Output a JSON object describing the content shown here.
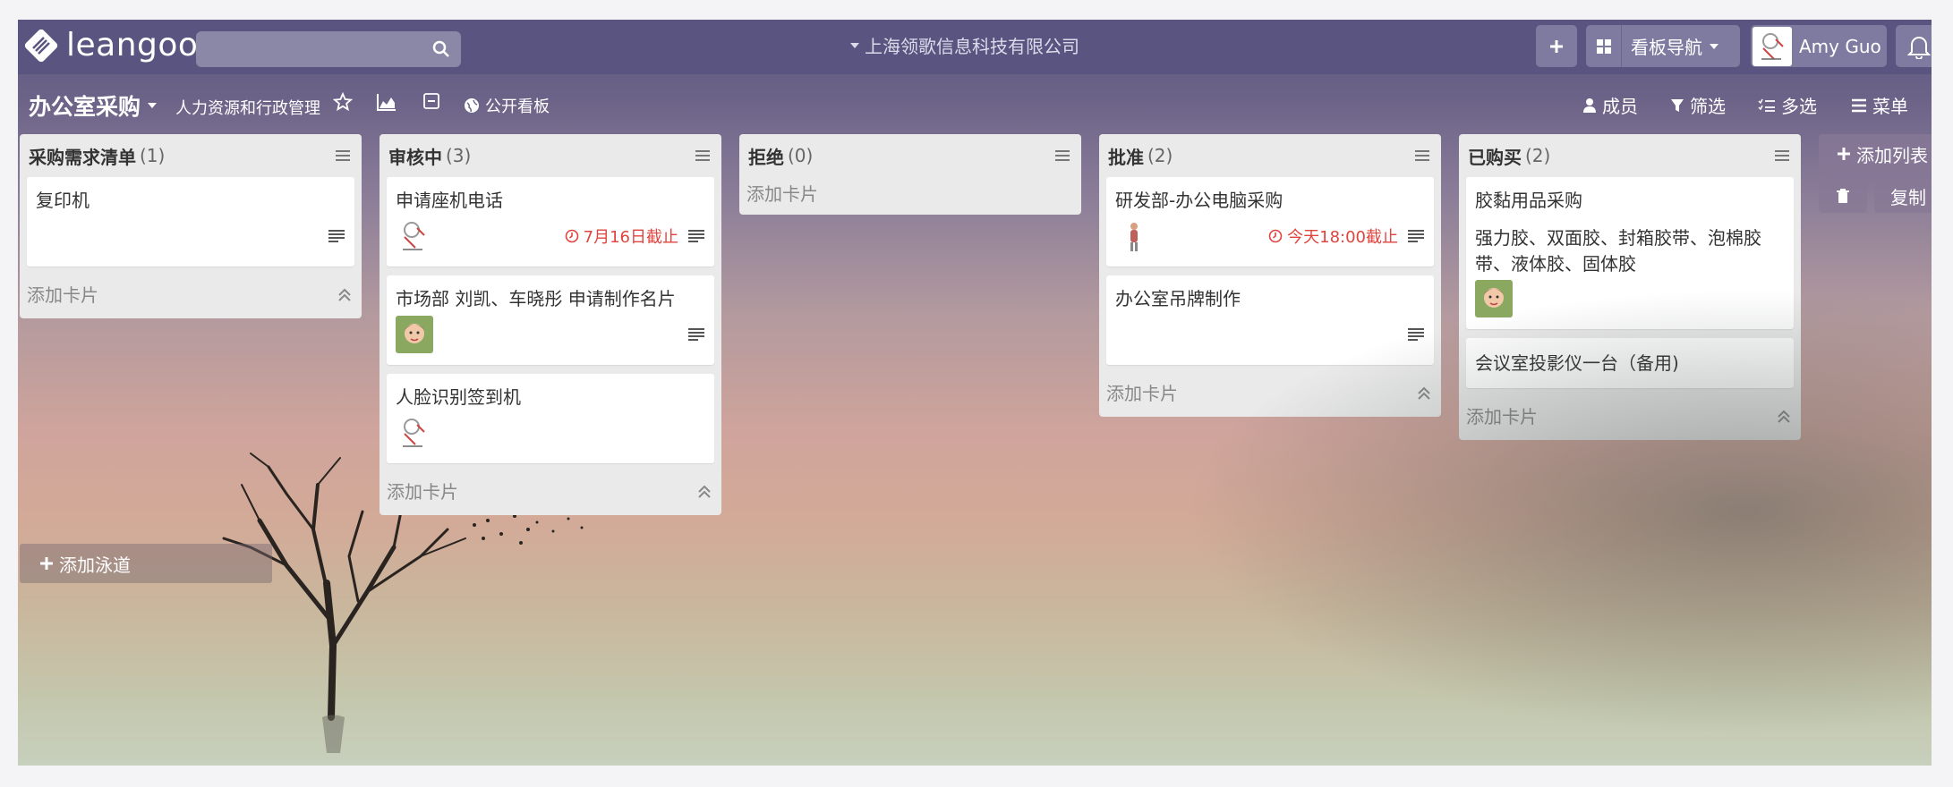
{
  "app": {
    "logo_text": "leangoo"
  },
  "search": {
    "placeholder": "",
    "value": ""
  },
  "org": {
    "name": "上海领歌信息科技有限公司"
  },
  "topbar": {
    "board_nav_label": "看板导航",
    "user_name": "Amy Guo"
  },
  "board": {
    "title": "办公室采购",
    "group": "人力资源和行政管理",
    "public_label": "公开看板",
    "actions": {
      "members": "成员",
      "filter": "筛选",
      "multi": "多选",
      "menu": "菜单"
    }
  },
  "lists": [
    {
      "title": "采购需求清单",
      "count": "(1)",
      "add_card": "添加卡片",
      "cards": [
        {
          "title": "复印机"
        }
      ]
    },
    {
      "title": "审核中",
      "count": "(3)",
      "add_card": "添加卡片",
      "cards": [
        {
          "title": "申请座机电话",
          "due": "7月16日截止"
        },
        {
          "title": "市场部 刘凯、车晓彤 申请制作名片"
        },
        {
          "title": "人脸识别签到机"
        }
      ]
    },
    {
      "title": "拒绝",
      "count": "(0)",
      "add_card": "添加卡片",
      "cards": []
    },
    {
      "title": "批准",
      "count": "(2)",
      "add_card": "添加卡片",
      "cards": [
        {
          "title": "研发部-办公电脑采购",
          "due": "今天18:00截止"
        },
        {
          "title": "办公室吊牌制作"
        }
      ]
    },
    {
      "title": "已购买",
      "count": "(2)",
      "add_card": "添加卡片",
      "cards": [
        {
          "title": "胶黏用品采购",
          "desc": "强力胶、双面胶、封箱胶带、泡棉胶带、液体胶、固体胶"
        },
        {
          "title": "会议室投影仪一台（备用)"
        }
      ]
    }
  ],
  "add_list_label": "添加列表",
  "copy_label": "复制",
  "add_swimlane_label": "添加泳道",
  "colors": {
    "topbar": "#5a5580",
    "due": "#e0443e",
    "list_bg": "#eaeaea"
  }
}
